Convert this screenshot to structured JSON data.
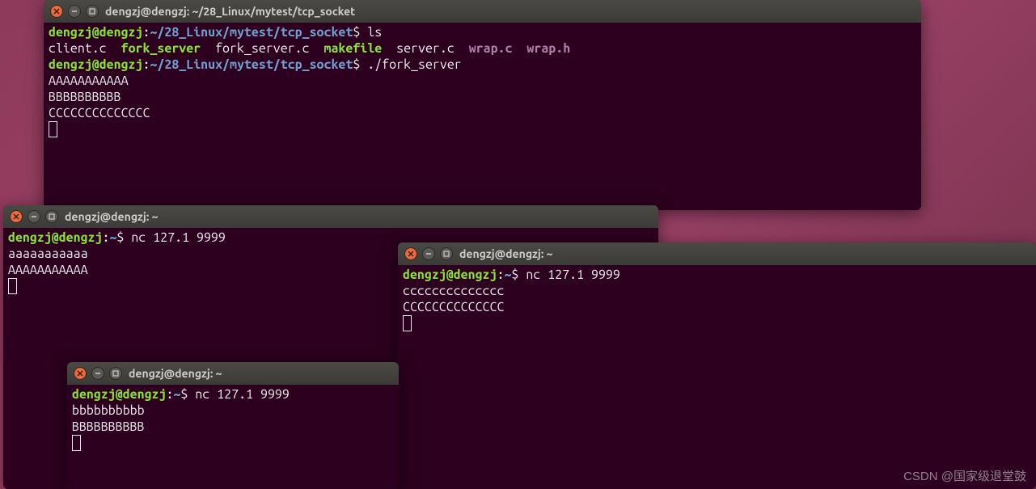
{
  "watermark": "CSDN @国家级退堂鼓",
  "term1": {
    "title": "dengzj@dengzj: ~/28_Linux/mytest/tcp_socket",
    "user": "dengzj@dengzj",
    "path": "~/28_Linux/mytest/tcp_socket",
    "cmd1": "ls",
    "ls": {
      "f1": "client.c",
      "f2": "fork_server",
      "f3": "fork_server.c",
      "f4": "makefile",
      "f5": "server.c",
      "f6": "wrap.c",
      "f7": "wrap.h"
    },
    "cmd2": "./fork_server",
    "out1": "AAAAAAAAAAA",
    "out2": "BBBBBBBBBB",
    "out3": "CCCCCCCCCCCCCC"
  },
  "term2": {
    "title": "dengzj@dengzj: ~",
    "user": "dengzj@dengzj",
    "path": "~",
    "cmd": "nc 127.1 9999",
    "out1": "aaaaaaaaaaa",
    "out2": "AAAAAAAAAAA"
  },
  "term3": {
    "title": "dengzj@dengzj: ~",
    "user": "dengzj@dengzj",
    "path": "~",
    "cmd": "nc 127.1 9999",
    "out1": "cccccccccccccc",
    "out2": "CCCCCCCCCCCCCC"
  },
  "term4": {
    "title": "dengzj@dengzj: ~",
    "user": "dengzj@dengzj",
    "path": "~",
    "cmd": "nc 127.1 9999",
    "out1": "bbbbbbbbbb",
    "out2": "BBBBBBBBBB"
  }
}
